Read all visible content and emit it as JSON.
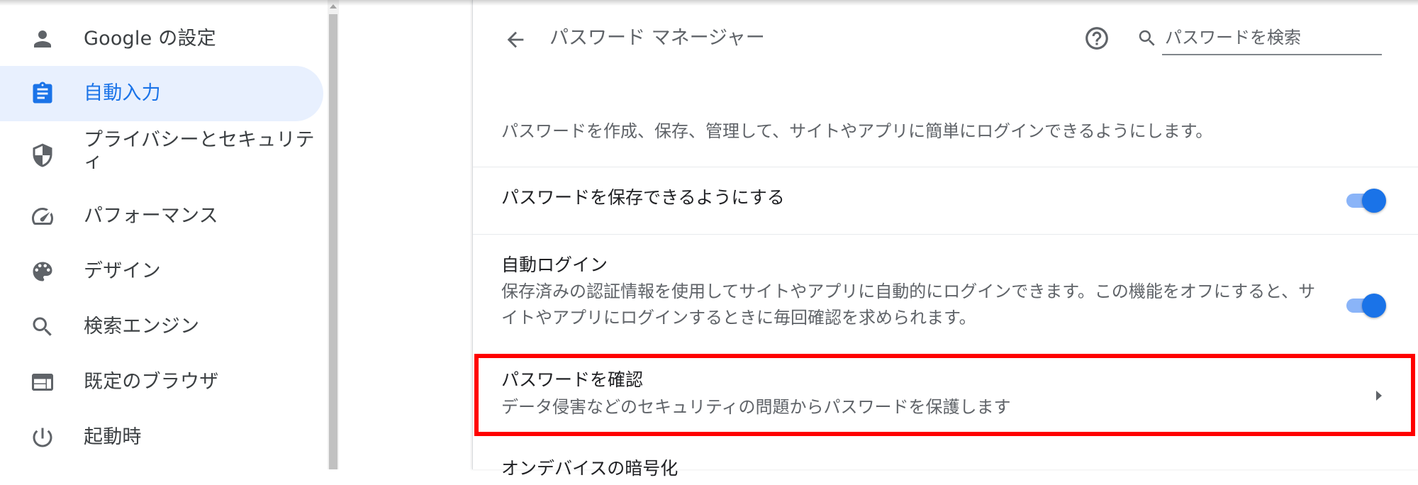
{
  "sidebar": {
    "items": [
      {
        "label": "Google の設定",
        "icon": "person-icon",
        "active": false
      },
      {
        "label": "自動入力",
        "icon": "clipboard-icon",
        "active": true
      },
      {
        "label": "プライバシーとセキュリティ",
        "icon": "shield-icon",
        "active": false
      },
      {
        "label": "パフォーマンス",
        "icon": "speedometer-icon",
        "active": false
      },
      {
        "label": "デザイン",
        "icon": "palette-icon",
        "active": false
      },
      {
        "label": "検索エンジン",
        "icon": "search-icon",
        "active": false
      },
      {
        "label": "既定のブラウザ",
        "icon": "browser-window-icon",
        "active": false
      },
      {
        "label": "起動時",
        "icon": "power-icon",
        "active": false
      }
    ]
  },
  "header": {
    "title": "パスワード マネージャー",
    "search_placeholder": "パスワードを検索"
  },
  "main": {
    "description": "パスワードを作成、保存、管理して、サイトやアプリに簡単にログインできるようにします。",
    "rows": [
      {
        "title": "パスワードを保存できるようにする",
        "toggle_on": true
      },
      {
        "title": "自動ログイン",
        "subtitle": "保存済みの認証情報を使用してサイトやアプリに自動的にログインできます。この機能をオフにすると、サイトやアプリにログインするときに毎回確認を求められます。",
        "toggle_on": true
      },
      {
        "title": "パスワードを確認",
        "subtitle": "データ侵害などのセキュリティの問題からパスワードを保護します",
        "highlighted": true
      },
      {
        "title": "オンデバイスの暗号化"
      }
    ]
  },
  "colors": {
    "accent": "#1a73e8",
    "active_bg": "#e8f0fe",
    "highlight": "#ff0000",
    "toggle_track": "#8ab4f8"
  }
}
